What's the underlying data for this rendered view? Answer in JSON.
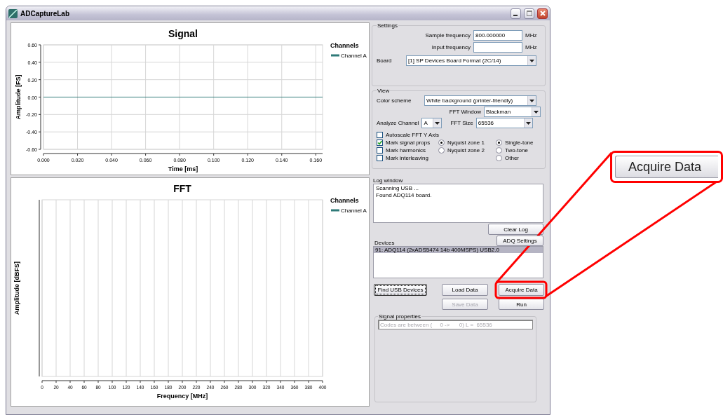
{
  "window": {
    "title": "ADCaptureLab"
  },
  "signal_plot": {
    "legend_title": "Channels",
    "chart_data": {
      "type": "line",
      "grid": true,
      "title": "Signal",
      "xlabel": "Time [ms]",
      "ylabel": "Amplitude [FS]",
      "x": [
        0,
        0.164
      ],
      "xlim": [
        0,
        0.164
      ],
      "ylim": [
        -0.6,
        0.6
      ],
      "xticks": [
        {
          "value": 0,
          "label": "0.000"
        },
        {
          "value": 0.02,
          "label": "0.020"
        },
        {
          "value": 0.04,
          "label": "0.040"
        },
        {
          "value": 0.06,
          "label": "0.060"
        },
        {
          "value": 0.08,
          "label": "0.080"
        },
        {
          "value": 0.1,
          "label": "0.100"
        },
        {
          "value": 0.12,
          "label": "0.120"
        },
        {
          "value": 0.14,
          "label": "0.140"
        },
        {
          "value": 0.16,
          "label": "0.160"
        }
      ],
      "yticks": [
        {
          "value": 0.6,
          "label": "0.60"
        },
        {
          "value": 0.4,
          "label": "0.40"
        },
        {
          "value": 0.2,
          "label": "0.20"
        },
        {
          "value": 0,
          "label": "0.00"
        },
        {
          "value": -0.2,
          "label": "-0.20"
        },
        {
          "value": -0.4,
          "label": "-0.40"
        },
        {
          "value": -0.6,
          "label": "-0.60"
        }
      ],
      "series": [
        {
          "name": "Channel A",
          "color": "#2f7a78",
          "values": [
            0,
            0
          ]
        }
      ]
    }
  },
  "fft_plot": {
    "legend_title": "Channels",
    "title": "FFT",
    "xlabel": "Frequency [MHz]",
    "ylabel": "Amplitude [dBFS]",
    "x_tick_labels": [
      "0",
      "20",
      "40",
      "60",
      "80",
      "100",
      "120",
      "140",
      "160",
      "180",
      "200",
      "220",
      "240",
      "260",
      "280",
      "300",
      "320",
      "340",
      "360",
      "380",
      "400"
    ],
    "legend": [
      {
        "name": "Channel A",
        "color": "#2f7a78"
      }
    ]
  },
  "settings": {
    "title": "Settings",
    "fields": [
      {
        "label": "Sample frequency",
        "value": "800.000000",
        "unit": "MHz"
      },
      {
        "label": "Input frequency",
        "unit": "MHz"
      }
    ],
    "board": {
      "label": "Board",
      "value": "[1] SP Devices Board Format (2C/14)"
    }
  },
  "view": {
    "title": "View",
    "color_scheme": {
      "label": "Color scheme",
      "value": "White background (printer-friendly)"
    },
    "fft_window": {
      "label": "FFT Window",
      "value": "Blackman"
    },
    "analyze_channel": {
      "label": "Analyze Channel",
      "value": "A"
    },
    "fft_size": {
      "label": "FFT Size",
      "value": "65536"
    },
    "checkboxes": [
      {
        "label": "Autoscale FFT Y Axis",
        "checked": false
      },
      {
        "label": "Mark signal props",
        "checked": true
      },
      {
        "label": "Mark harmonics",
        "checked": false
      },
      {
        "label": "Mark interleaving",
        "checked": false
      }
    ],
    "nyquist_radios": [
      {
        "label": "Nyquist zone 1",
        "selected": true
      },
      {
        "label": "Nyquist zone 2",
        "selected": false
      }
    ],
    "tone_radios": [
      {
        "label": "Single-tone",
        "selected": true
      },
      {
        "label": "Two-tone",
        "selected": false
      },
      {
        "label": "Other",
        "selected": false
      }
    ]
  },
  "log_window": {
    "title": "Log window",
    "lines": [
      "Scanning USB ...",
      "Found ADQ114 board."
    ]
  },
  "clear_log_button": {
    "label": "Clear Log"
  },
  "adq_settings_button": {
    "label": "ADQ Settings"
  },
  "devices": {
    "title": "Devices",
    "items": [
      {
        "label": "91: ADQ114 (2xADS5474 14b 400MSPS) USB2.0",
        "selected": true
      }
    ]
  },
  "action_buttons": [
    {
      "label": "Find USB Devices",
      "disabled": false,
      "focused": true
    },
    {
      "label": "Load Data",
      "disabled": false,
      "focused": false
    },
    {
      "label": "Acquire Data",
      "disabled": false,
      "focused": false
    },
    {
      "label": "Save Data",
      "disabled": true,
      "focused": false
    },
    {
      "label": "Run",
      "disabled": false,
      "focused": false
    }
  ],
  "signal_properties": {
    "title": "Signal properties",
    "text": "Codes are between (     0 ->      0) L =  65536"
  },
  "callout": {
    "label": "Acquire Data"
  }
}
